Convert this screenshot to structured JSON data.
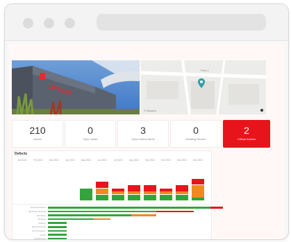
{
  "colors": {
    "green": "#35a33c",
    "orange": "#f08a1c",
    "red": "#e8141b",
    "pin": "#2f9fa6"
  },
  "browser": {
    "dots": 3
  },
  "photo": {
    "sign_text": "UPTION",
    "logo_text": "C"
  },
  "map": {
    "street_label": "Pers.2",
    "attribution": "© Mapbox"
  },
  "stats": [
    {
      "value": "210",
      "label": "Issues"
    },
    {
      "value": "0",
      "label": "Open Tasks"
    },
    {
      "value": "3",
      "label": "Open Defect Items"
    },
    {
      "value": "0",
      "label": "Awaiting Review"
    },
    {
      "value": "2",
      "label": "Critical Actions",
      "alert": true
    }
  ],
  "panel": {
    "title": "Defects"
  },
  "chart_data": {
    "type": "bar",
    "stacked": true,
    "categories": [
      "Jan 2023",
      "Feb 2023",
      "Mar 2023",
      "Apr 2023",
      "May 2023",
      "Jun 2023",
      "Jul 2023",
      "Aug 2023",
      "Sep 2023",
      "Oct 2023",
      "Nov 2023",
      "Dec 2023"
    ],
    "series": [
      {
        "color": "#35a33c",
        "values": [
          0,
          0,
          0,
          0,
          4,
          2,
          2,
          2,
          2,
          2,
          2,
          1
        ]
      },
      {
        "color": "#f08a1c",
        "values": [
          0,
          0,
          0,
          0,
          0,
          2,
          1,
          1,
          1,
          1,
          1,
          4
        ]
      },
      {
        "color": "#e8141b",
        "values": [
          0,
          0,
          0,
          0,
          0,
          2,
          1,
          2,
          2,
          1,
          2,
          2
        ]
      }
    ]
  },
  "hbars": {
    "rows": [
      {
        "label": "Structural Works",
        "segments": [
          {
            "value": 78,
            "color": "#35a33c"
          },
          {
            "value": 6,
            "color": "#e8141b"
          }
        ]
      },
      {
        "label": "Electrical Services",
        "segments": [
          {
            "value": 52,
            "color": "#35a33c"
          },
          {
            "value": 18,
            "color": "#e8141b"
          }
        ]
      },
      {
        "label": "Plumbing",
        "segments": [
          {
            "value": 40,
            "color": "#35a33c"
          },
          {
            "value": 12,
            "color": "#f08a1c"
          }
        ]
      },
      {
        "label": "Finishes",
        "segments": [
          {
            "value": 22,
            "color": "#35a33c"
          },
          {
            "value": 8,
            "color": "#f08a1c"
          }
        ]
      },
      {
        "label": "Roofing",
        "segments": [
          {
            "value": 9,
            "color": "#35a33c"
          }
        ]
      },
      {
        "label": "External Works",
        "segments": [
          {
            "value": 9,
            "color": "#35a33c"
          }
        ]
      },
      {
        "label": "Fire Protection",
        "segments": [
          {
            "value": 9,
            "color": "#35a33c"
          }
        ]
      },
      {
        "label": "HVAC",
        "segments": [
          {
            "value": 9,
            "color": "#35a33c"
          }
        ]
      },
      {
        "label": "Landscaping",
        "segments": [
          {
            "value": 9,
            "color": "#35a33c"
          }
        ]
      }
    ]
  }
}
